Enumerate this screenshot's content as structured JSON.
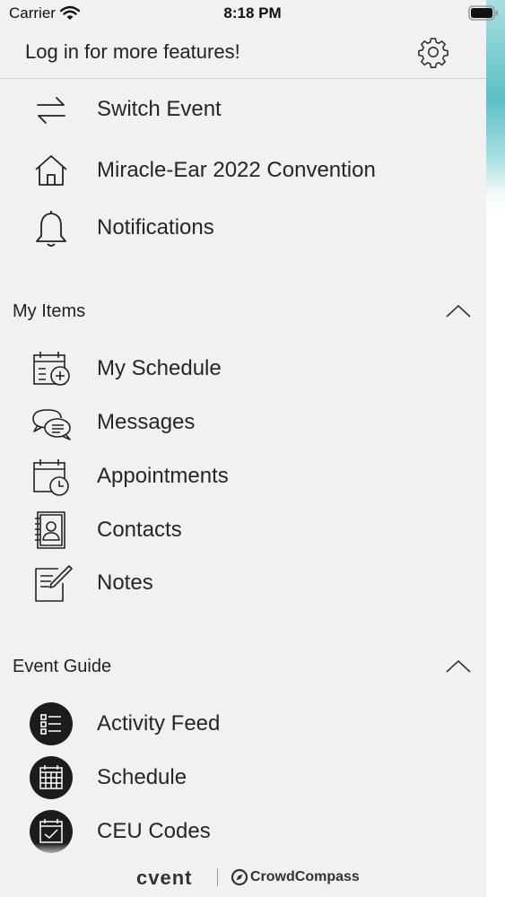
{
  "status_bar": {
    "carrier": "Carrier",
    "time": "8:18 PM",
    "wifi_icon": "wifi-icon",
    "battery_icon": "battery-icon"
  },
  "header": {
    "title": "Log in for more features!",
    "settings_icon": "gear-icon"
  },
  "top_items": [
    {
      "label": "Switch Event",
      "icon": "switch-arrows-icon"
    },
    {
      "label": "Miracle-Ear 2022 Convention",
      "icon": "home-icon"
    },
    {
      "label": "Notifications",
      "icon": "bell-icon"
    }
  ],
  "my_items": {
    "title": "My Items",
    "collapse_icon": "chevron-up-icon",
    "items": [
      {
        "label": "My Schedule",
        "icon": "calendar-add-icon"
      },
      {
        "label": "Messages",
        "icon": "chat-bubbles-icon"
      },
      {
        "label": "Appointments",
        "icon": "calendar-clock-icon"
      },
      {
        "label": "Contacts",
        "icon": "address-book-icon"
      },
      {
        "label": "Notes",
        "icon": "note-pencil-icon"
      }
    ]
  },
  "event_guide": {
    "title": "Event Guide",
    "collapse_icon": "chevron-up-icon",
    "items": [
      {
        "label": "Activity Feed",
        "icon": "list-icon"
      },
      {
        "label": "Schedule",
        "icon": "calendar-grid-icon"
      },
      {
        "label": "CEU Codes",
        "icon": "calendar-check-icon"
      }
    ]
  },
  "footer": {
    "brand": "cvent",
    "partner": "CrowdCompass"
  },
  "colors": {
    "drawer_background": "#f2f1f1",
    "text": "#262626",
    "accent_teal": "#5cbfc7",
    "icon_circle": "#1c1c1c"
  }
}
